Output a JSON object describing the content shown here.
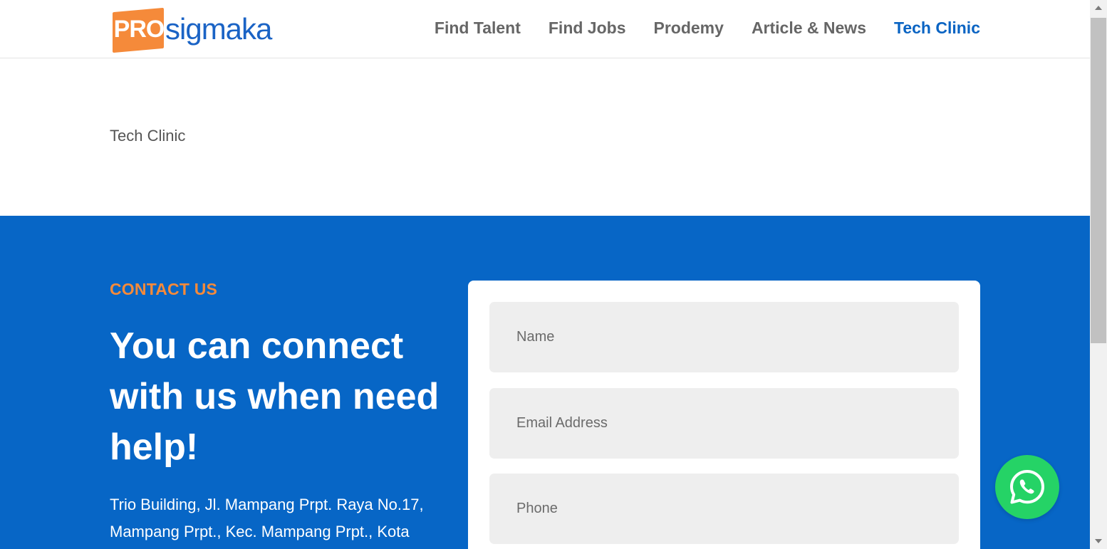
{
  "header": {
    "logo": {
      "badge": "PRO",
      "text": "sigmaka"
    },
    "nav": [
      {
        "label": "Find Talent",
        "active": false
      },
      {
        "label": "Find Jobs",
        "active": false
      },
      {
        "label": "Prodemy",
        "active": false
      },
      {
        "label": "Article & News",
        "active": false
      },
      {
        "label": "Tech Clinic",
        "active": true
      }
    ]
  },
  "page": {
    "title": "Tech Clinic"
  },
  "contact": {
    "eyebrow": "CONTACT US",
    "headline": "You can connect with us when need help!",
    "address": "Trio Building, Jl. Mampang Prpt. Raya No.17, Mampang Prpt., Kec. Mampang Prpt., Kota",
    "form": {
      "name_placeholder": "Name",
      "email_placeholder": "Email Address",
      "phone_placeholder": "Phone"
    }
  },
  "colors": {
    "brand_blue": "#0766c6",
    "accent_orange": "#f58a3a",
    "whatsapp_green": "#25d366"
  },
  "icons": {
    "floating_button": "whatsapp-icon"
  }
}
